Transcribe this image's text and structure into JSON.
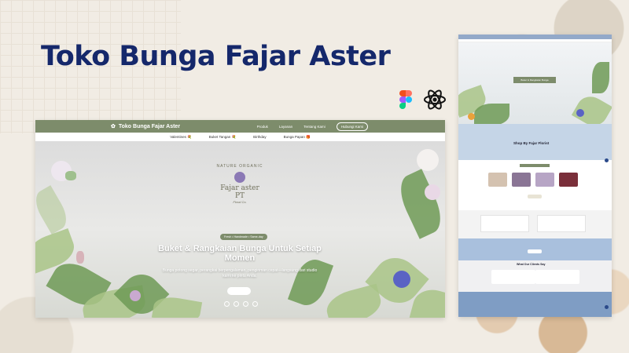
{
  "title": "Toko Bunga Fajar Aster",
  "tools": [
    {
      "icon": "figma-icon"
    },
    {
      "icon": "react-icon"
    }
  ],
  "colors": {
    "title": "#15286b",
    "nav": "#7d8c6b",
    "hero_text": "#ffffff",
    "side_accent": "#93a9c9"
  },
  "mockup": {
    "brand": "Toko Bunga Fajar Aster",
    "nav": [
      "Produk",
      "Layanan",
      "Tentang Kami"
    ],
    "nav_button": "Hubungi Kami",
    "categories": [
      "Valentines 💐",
      "Buket Tangan 💐",
      "Birthday",
      "Bunga Papan 🎁"
    ],
    "logo": {
      "arc": "NATURE ORGANIC",
      "name": "Fajar aster PT",
      "sub": "Floral Co."
    },
    "pill": "Fresh • Handmade • Same-day",
    "hero_title": "Buket & Rangkaian Bunga Untuk Setiap Momen",
    "hero_text": "Bunga potong segar, perangkai berpengalaman, pengiriman cepat—langsung dari studio kami ke pintu Anda."
  },
  "side": {
    "hero_tag": "Buket & Rangkaian Bunga",
    "shop_title": "Shop By Fajar Florist",
    "best_title": "Best Sellers",
    "testimonials_title": "What Our Clients Say"
  }
}
